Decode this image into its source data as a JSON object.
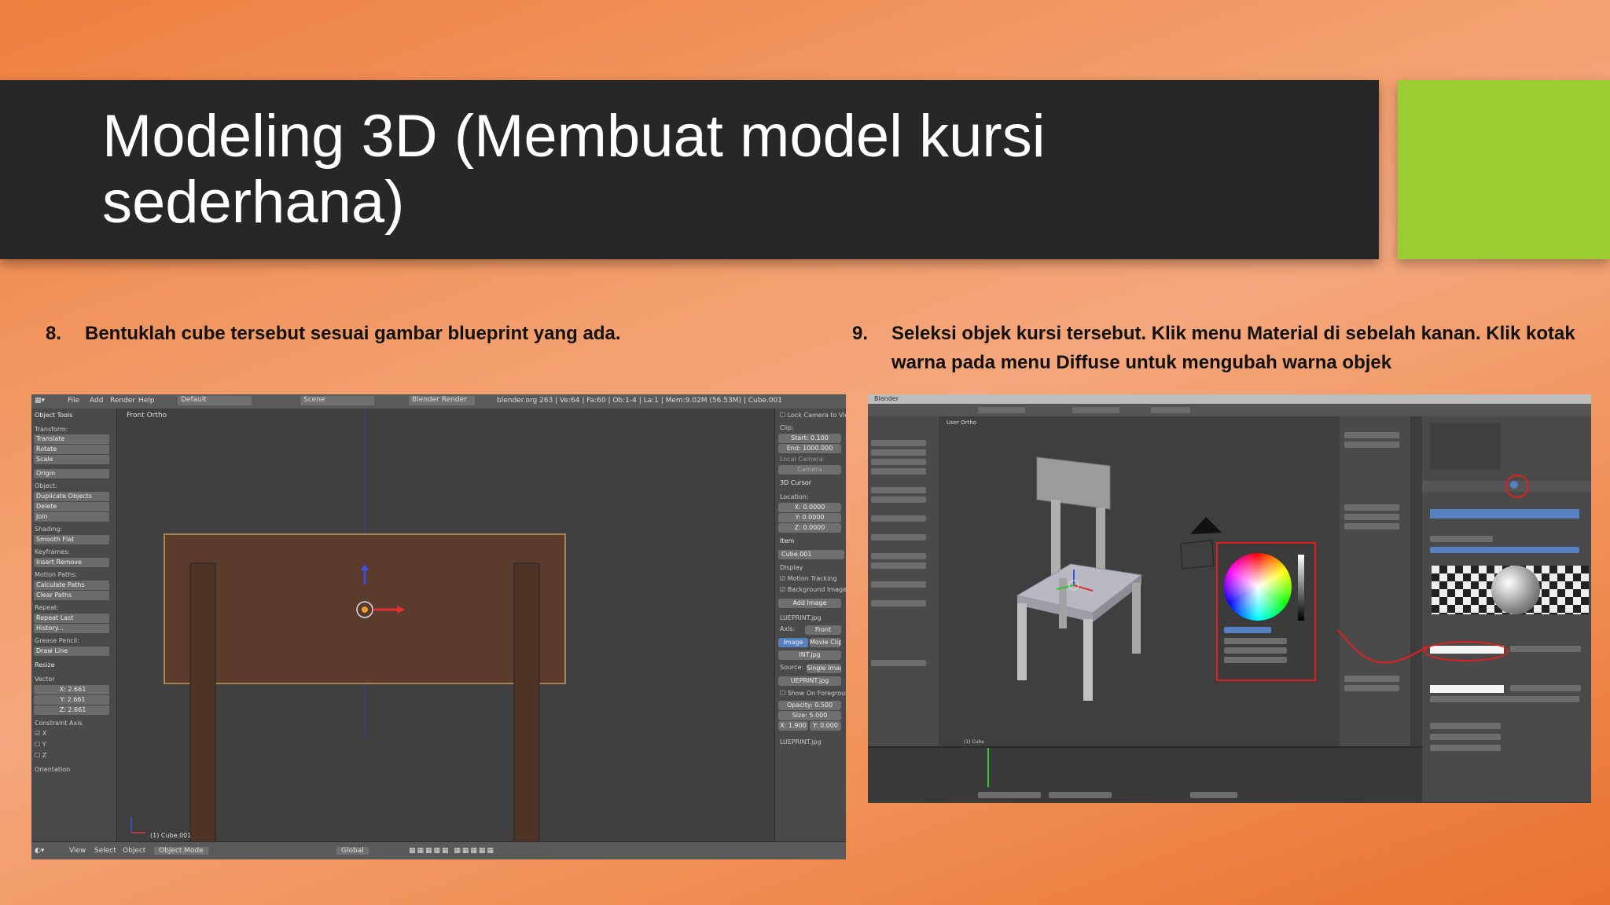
{
  "slide": {
    "title": "Modeling 3D (Membuat model kursi sederhana)",
    "colors": {
      "title_bar": "#272727",
      "accent_block": "#9acd32",
      "background": "#f29a66"
    }
  },
  "steps": [
    {
      "number": "8.",
      "text": "Bentuklah cube tersebut sesuai gambar blueprint yang ada."
    },
    {
      "number": "9.",
      "text": "Seleksi objek kursi tersebut. Klik menu Material di sebelah kanan. Klik kotak warna pada menu Diffuse untuk mengubah warna objek"
    }
  ],
  "screenshot1": {
    "header": {
      "menus": [
        "File",
        "Add",
        "Render",
        "Help"
      ],
      "layout": "Default",
      "scene": "Scene",
      "engine": "Blender Render",
      "status": "blender.org 263 | Ve:64 | Fa:60 | Ob:1-4 | La:1 | Mem:9.02M (56.53M) | Cube.001"
    },
    "tool_panel": {
      "title": "Object Tools",
      "sections": [
        {
          "label": "Transform:",
          "buttons": [
            "Translate",
            "Rotate",
            "Scale"
          ]
        },
        {
          "label": "",
          "buttons": [
            "Origin"
          ]
        },
        {
          "label": "Object:",
          "buttons": [
            "Duplicate Objects",
            "Delete",
            "Join"
          ]
        },
        {
          "label": "Shading:",
          "buttons": [
            "Smooth   Flat"
          ]
        },
        {
          "label": "Keyframes:",
          "buttons": [
            "Insert   Remove"
          ]
        },
        {
          "label": "Motion Paths:",
          "buttons": [
            "Calculate Paths",
            "Clear Paths"
          ]
        },
        {
          "label": "Repeat:",
          "buttons": [
            "Repeat Last",
            "History..."
          ]
        },
        {
          "label": "Grease Pencil:",
          "buttons": [
            "Draw   Line"
          ]
        }
      ],
      "resize_title": "Resize",
      "vector_label": "Vector",
      "vector": [
        "X: 2.661",
        "Y: 2.661",
        "Z: 2.661"
      ],
      "constraint_label": "Constraint Axis",
      "axes": [
        "X",
        "Y",
        "Z"
      ],
      "orientation": "Orientation"
    },
    "viewport": {
      "view_label": "Front Ortho",
      "object_label": "(1) Cube.001"
    },
    "n_panel": {
      "lock_camera": "Lock Camera to View",
      "clip_label": "Clip:",
      "clip_start": "Start: 0.100",
      "clip_end": "End: 1000.000",
      "local_camera": "Local Camera:",
      "camera": "Camera",
      "cursor_title": "3D Cursor",
      "location_label": "Location:",
      "cursor": [
        "X: 0.0000",
        "Y: 0.0000",
        "Z: 0.0000"
      ],
      "item_title": "Item",
      "item_name": "Cube.001",
      "display": "Display",
      "motion_tracking": "Motion Tracking",
      "background_images": "Background Images",
      "add_image": "Add Image",
      "image_name": "LUEPRINT.jpg",
      "axis_label": "Axis:",
      "axis_value": "Front",
      "tab_image": "Image",
      "tab_movie": "Movie Clip",
      "image_file": "INT.jpg",
      "source_label": "Source:",
      "source_value": "Single Imag",
      "file2": "UEPRINT.jpg",
      "show_foreground": "Show On Foreground",
      "opacity": "Opacity: 0.500",
      "size": "Size: 5.000",
      "offset_x": "X: 1.900",
      "offset_y": "Y: 0.000",
      "last": "LUEPRINT.jpg"
    },
    "footer": {
      "menus": [
        "View",
        "Select",
        "Object"
      ],
      "mode": "Object Mode",
      "orientation": "Global"
    }
  },
  "screenshot2": {
    "window_title": "Blender",
    "viewport_label": "User Ortho",
    "object_label": "(1) Cube"
  }
}
